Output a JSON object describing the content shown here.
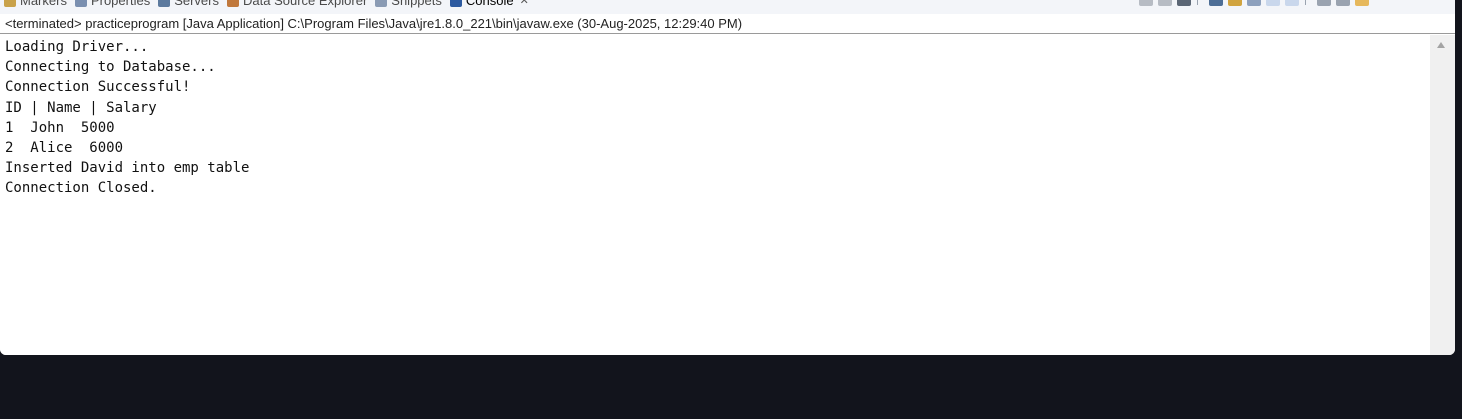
{
  "tabs": [
    {
      "label": "Markers",
      "icon": "markers-icon",
      "color": "#c9a24a"
    },
    {
      "label": "Properties",
      "icon": "properties-icon",
      "color": "#7a8fb0"
    },
    {
      "label": "Servers",
      "icon": "servers-icon",
      "color": "#5c7a9e"
    },
    {
      "label": "Data Source Explorer",
      "icon": "data-source-icon",
      "color": "#c0783c"
    },
    {
      "label": "Snippets",
      "icon": "snippets-icon",
      "color": "#8a9bb4"
    },
    {
      "label": "Console",
      "icon": "console-icon",
      "color": "#2d5aa0",
      "active": true,
      "close": "✕"
    }
  ],
  "status": "<terminated> practiceprogram [Java Application] C:\\Program Files\\Java\\jre1.8.0_221\\bin\\javaw.exe (30-Aug-2025, 12:29:40 PM)",
  "console_lines": [
    "Loading Driver...",
    "Connecting to Database...",
    "Connection Successful!",
    "ID | Name | Salary",
    "1  John  5000",
    "2  Alice  6000",
    "Inserted David into emp table",
    "Connection Closed."
  ],
  "colors": {
    "background": "#12141c",
    "panel": "#ffffff",
    "tabbar": "#f3f5f9",
    "scrollbar": "#f0f0f0"
  }
}
